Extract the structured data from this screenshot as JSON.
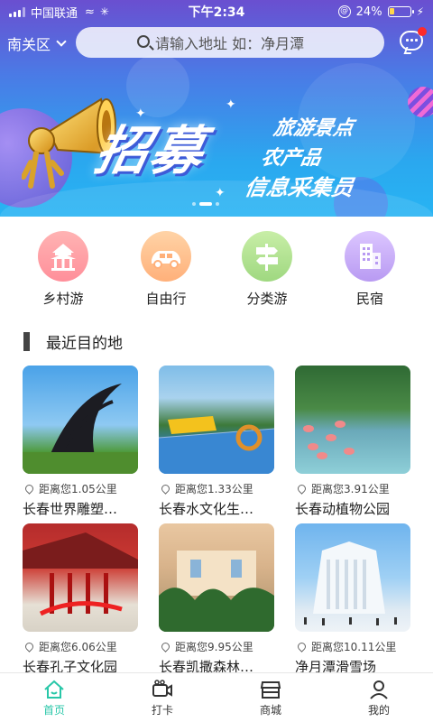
{
  "status_bar": {
    "carrier": "中国联通",
    "time": "下午2:34",
    "battery": "24%",
    "battery_level": 0.24
  },
  "header": {
    "city": "南关区",
    "search_placeholder": "请输入地址  如：净月潭"
  },
  "banner": {
    "title": "招募",
    "lines": [
      "旅游景点",
      "农产品",
      "信息采集员"
    ],
    "slides": 3,
    "active_slide": 2
  },
  "categories": [
    {
      "label": "乡村游",
      "icon": "pavilion-icon"
    },
    {
      "label": "自由行",
      "icon": "car-icon"
    },
    {
      "label": "分类游",
      "icon": "signpost-icon"
    },
    {
      "label": "民宿",
      "icon": "building-icon"
    }
  ],
  "section": {
    "title": "最近目的地"
  },
  "destinations": [
    {
      "distance": "距离您1.05公里",
      "name": "长春世界雕塑…"
    },
    {
      "distance": "距离您1.33公里",
      "name": "长春水文化生…"
    },
    {
      "distance": "距离您3.91公里",
      "name": "长春动植物公园"
    },
    {
      "distance": "距离您6.06公里",
      "name": "长春孔子文化园"
    },
    {
      "distance": "距离您9.95公里",
      "name": "长春凯撒森林…"
    },
    {
      "distance": "距离您10.11公里",
      "name": "净月潭滑雪场"
    }
  ],
  "nav": [
    {
      "label": "首页",
      "icon": "home-icon",
      "active": true
    },
    {
      "label": "打卡",
      "icon": "camera-icon",
      "active": false
    },
    {
      "label": "商城",
      "icon": "shop-icon",
      "active": false
    },
    {
      "label": "我的",
      "icon": "user-icon",
      "active": false
    }
  ],
  "colors": {
    "accent": "#28c7a8",
    "notification": "#ff2a2a"
  }
}
